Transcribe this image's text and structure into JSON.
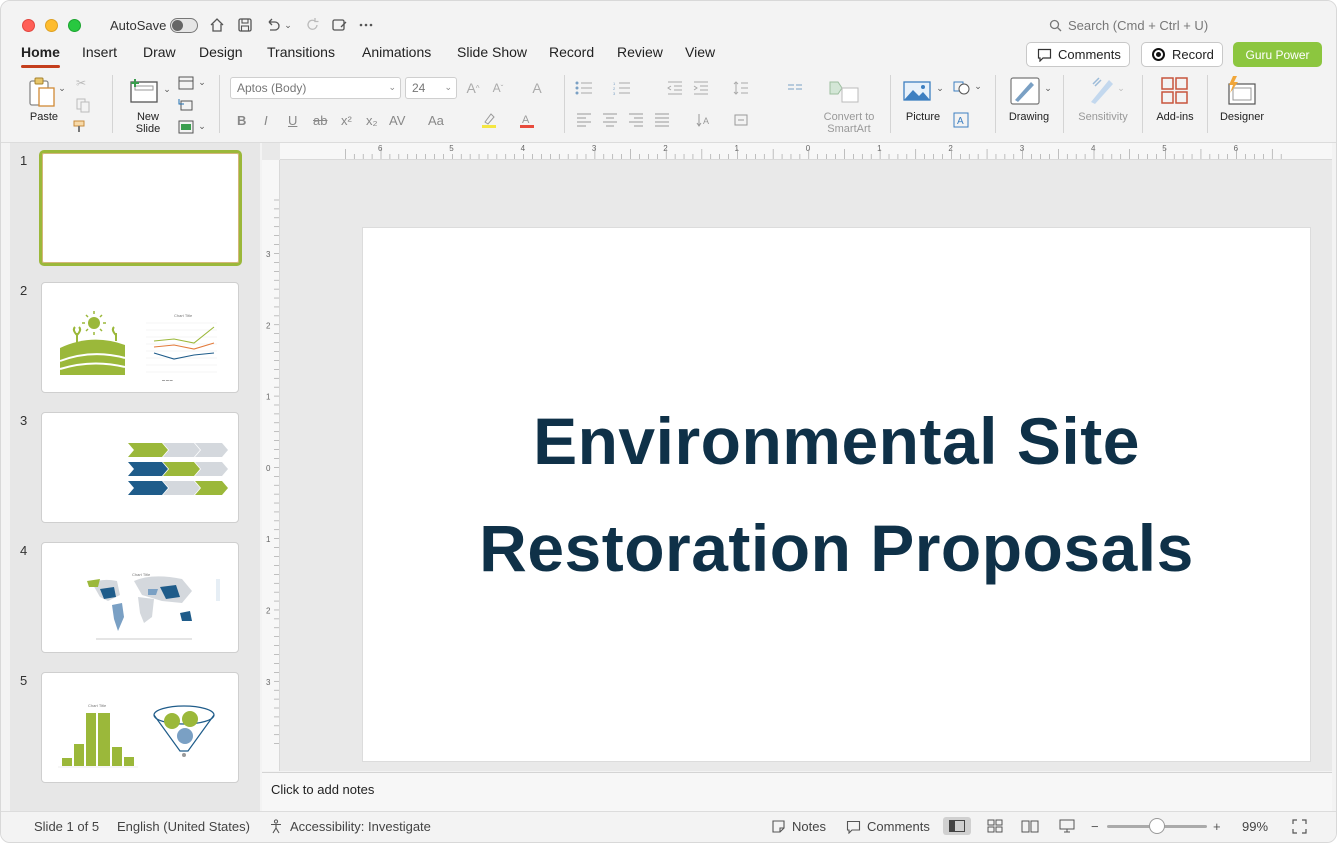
{
  "titlebar": {
    "autosave_label": "AutoSave",
    "search_placeholder": "Search (Cmd + Ctrl + U)"
  },
  "tabs": [
    "Home",
    "Insert",
    "Draw",
    "Design",
    "Transitions",
    "Animations",
    "Slide Show",
    "Record",
    "Review",
    "View"
  ],
  "header_buttons": {
    "comments": "Comments",
    "record": "Record",
    "guru": "Guru Power",
    "guru_color": "#8cc63f"
  },
  "ribbon": {
    "paste": "Paste",
    "new_slide": "New\nSlide",
    "font_name": "Aptos (Body)",
    "font_size": "24",
    "convert_smartart": "Convert to\nSmartArt",
    "picture": "Picture",
    "drawing": "Drawing",
    "sensitivity": "Sensitivity",
    "addins": "Add-ins",
    "designer": "Designer"
  },
  "thumbnails": [
    {
      "num": "1"
    },
    {
      "num": "2"
    },
    {
      "num": "3"
    },
    {
      "num": "4"
    },
    {
      "num": "5"
    }
  ],
  "slide": {
    "title": "Environmental Site Restoration Proposals",
    "title_color": "#0f3148"
  },
  "notes": {
    "placeholder": "Click to add notes"
  },
  "status": {
    "slide_info": "Slide 1 of 5",
    "language": "English (United States)",
    "accessibility": "Accessibility: Investigate",
    "notes": "Notes",
    "comments": "Comments",
    "zoom": "99%"
  },
  "ruler": {
    "top_labels": [
      "6",
      "5",
      "4",
      "3",
      "2",
      "1",
      "0",
      "1",
      "2",
      "3",
      "4",
      "5",
      "6"
    ],
    "left_labels": [
      "3",
      "2",
      "1",
      "0",
      "1",
      "2",
      "3"
    ]
  }
}
